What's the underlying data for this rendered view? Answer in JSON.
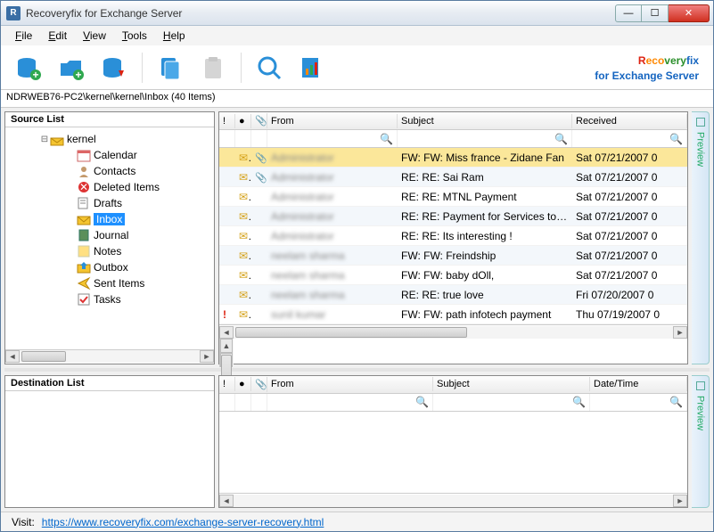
{
  "window": {
    "title": "Recoveryfix for Exchange Server"
  },
  "menu": {
    "file": "File",
    "edit": "Edit",
    "view": "View",
    "tools": "Tools",
    "help": "Help"
  },
  "brand": {
    "name": "Recoveryfix",
    "sub": "for Exchange Server"
  },
  "pathbar": "NDRWEB76-PC2\\kernel\\kernel\\Inbox   (40 Items)",
  "panels": {
    "source": "Source List",
    "destination": "Destination List"
  },
  "tree": {
    "root": "kernel",
    "items": [
      "Calendar",
      "Contacts",
      "Deleted Items",
      "Drafts",
      "Inbox",
      "Journal",
      "Notes",
      "Outbox",
      "Sent Items",
      "Tasks"
    ],
    "selected": "Inbox"
  },
  "columns": {
    "from": "From",
    "subject": "Subject",
    "received": "Received",
    "datetime": "Date/Time"
  },
  "messages": [
    {
      "att": true,
      "from": "Administrator",
      "subject": "FW:  FW: Miss france - Zidane Fan",
      "received": "Sat 07/21/2007 0",
      "selected": true,
      "alt": false
    },
    {
      "att": true,
      "from": "Administrator",
      "subject": "RE:  RE: Sai Ram",
      "received": "Sat 07/21/2007 0",
      "alt": true
    },
    {
      "att": false,
      "from": "Administrator",
      "subject": "RE:  RE: MTNL Payment",
      "received": "Sat 07/21/2007 0",
      "alt": false
    },
    {
      "att": false,
      "from": "Administrator",
      "subject": "RE:  RE: Payment for Services to Orac...",
      "received": "Sat 07/21/2007 0",
      "alt": true
    },
    {
      "att": false,
      "from": "Administrator",
      "subject": "RE:  RE: Its interesting !",
      "received": "Sat 07/21/2007 0",
      "alt": false
    },
    {
      "att": false,
      "from": "neelam sharma",
      "subject": "FW:  FW: Freindship",
      "received": "Sat 07/21/2007 0",
      "alt": true
    },
    {
      "att": false,
      "from": "neelam sharma",
      "subject": "FW:  FW: baby dOll,",
      "received": "Sat 07/21/2007 0",
      "alt": false
    },
    {
      "att": false,
      "from": "neelam sharma",
      "subject": "RE:  RE: true love",
      "received": "Fri 07/20/2007 0",
      "alt": true
    },
    {
      "att": false,
      "imp": true,
      "from": "sunil kumar",
      "subject": "FW:  FW: path infotech payment",
      "received": "Thu 07/19/2007 0",
      "alt": false
    }
  ],
  "preview_label": "Preview",
  "status": {
    "visit": "Visit:",
    "url": "https://www.recoveryfix.com/exchange-server-recovery.html"
  }
}
